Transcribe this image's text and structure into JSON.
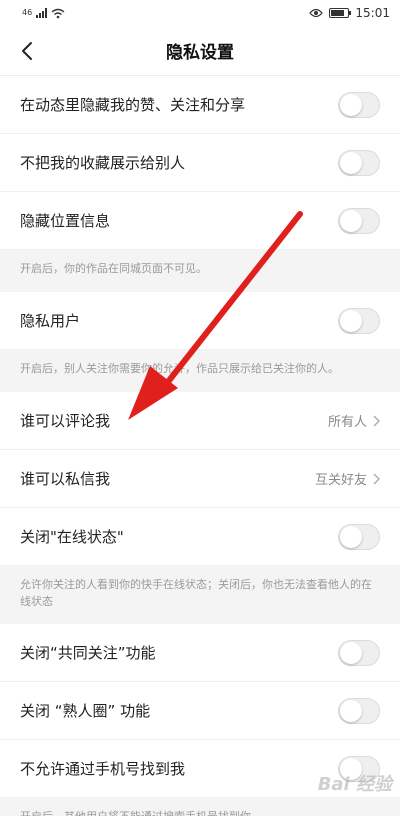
{
  "status": {
    "signal": "46",
    "time": "15:01"
  },
  "header": {
    "title": "隐私设置"
  },
  "rows": {
    "hide_activity": "在动态里隐藏我的赞、关注和分享",
    "hide_favorites": "不把我的收藏展示给别人",
    "hide_location": "隐藏位置信息",
    "private_user": "隐私用户",
    "who_comment": "谁可以评论我",
    "who_comment_value": "所有人",
    "who_message": "谁可以私信我",
    "who_message_value": "互关好友",
    "online_status": "关闭\"在线状态\"",
    "mutual_follow": "关闭“共同关注”功能",
    "acquaintance": "关闭 “熟人圈” 功能",
    "phone_search": "不允许通过手机号找到我"
  },
  "notes": {
    "location": "开启后，你的作品在同城页面不可见。",
    "private": "开启后，别人关注你需要你的允许，作品只展示给已关注你的人。",
    "online": "允许你关注的人看到你的快手在线状态；关闭后，你也无法查看他人的在线状态",
    "phone": "开启后，其他用户将不能通过搜索手机号找到你"
  },
  "watermark": "Bai 经验",
  "toggles": {
    "hide_activity": false,
    "hide_favorites": false,
    "hide_location": false,
    "private_user": false,
    "online_status": false,
    "mutual_follow": false,
    "acquaintance": false,
    "phone_search": false
  },
  "colors": {
    "arrow": "#e0201c",
    "note_bg": "#f4f4f4"
  },
  "icons": {
    "back": "chevron-left-icon",
    "chevron": "chevron-right-icon",
    "eye": "eye-icon",
    "wifi": "wifi-icon",
    "battery": "battery-icon"
  }
}
